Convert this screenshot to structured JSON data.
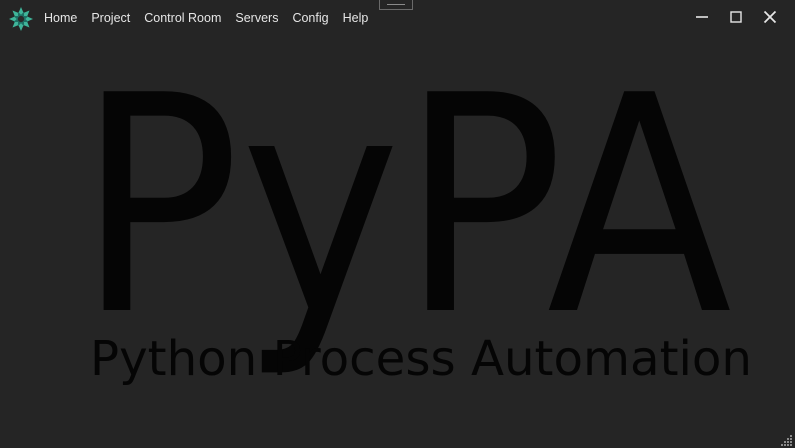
{
  "menu": {
    "items": [
      {
        "label": "Home"
      },
      {
        "label": "Project"
      },
      {
        "label": "Control Room"
      },
      {
        "label": "Servers"
      },
      {
        "label": "Config"
      },
      {
        "label": "Help"
      }
    ]
  },
  "window_controls": {
    "minimize": "minimize-icon",
    "maximize": "maximize-icon",
    "close": "close-icon"
  },
  "splash": {
    "logo_text": "PyPA",
    "tagline": "Python Process Automation"
  },
  "colors": {
    "background": "#252525",
    "menu_text": "#e6e6e6",
    "logo_text": "#050505",
    "brand_teal": "#2a9d8f"
  }
}
